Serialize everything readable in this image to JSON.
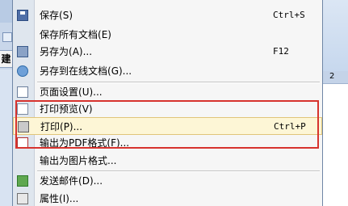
{
  "background_app": {
    "left_tab_label": "建",
    "ruler_mark": "2"
  },
  "menu": {
    "items": [
      {
        "label": "保存",
        "mnemonic": "(S)",
        "shortcut": "Ctrl+S",
        "icon": "save-icon"
      },
      {
        "label": "保存所有文档",
        "mnemonic": "(E)",
        "shortcut": "",
        "icon": ""
      },
      {
        "label": "另存为",
        "mnemonic": "(A)...",
        "shortcut": "F12",
        "icon": "save-as-icon"
      },
      {
        "label": "另存到在线文档",
        "mnemonic": "(G)...",
        "shortcut": "",
        "icon": "online-doc-icon"
      },
      {
        "label": "页面设置",
        "mnemonic": "(U)...",
        "shortcut": "",
        "icon": "page-setup-icon"
      },
      {
        "label": "打印预览",
        "mnemonic": "(V)",
        "shortcut": "",
        "icon": "print-preview-icon"
      },
      {
        "label": "打印",
        "mnemonic": "(P)...",
        "shortcut": "Ctrl+P",
        "icon": "printer-icon"
      },
      {
        "label": "输出为PDF格式",
        "mnemonic": "(F)...",
        "shortcut": "",
        "icon": "pdf-icon"
      },
      {
        "label": "输出为图片格式...",
        "mnemonic": "",
        "shortcut": "",
        "icon": ""
      },
      {
        "label": "发送邮件",
        "mnemonic": "(D)...",
        "shortcut": "",
        "icon": "send-email-icon"
      },
      {
        "label": "属性",
        "mnemonic": "(I)...",
        "shortcut": "",
        "icon": "properties-icon"
      }
    ],
    "highlighted_item": "打印",
    "annotation_color": "#d7332e"
  }
}
